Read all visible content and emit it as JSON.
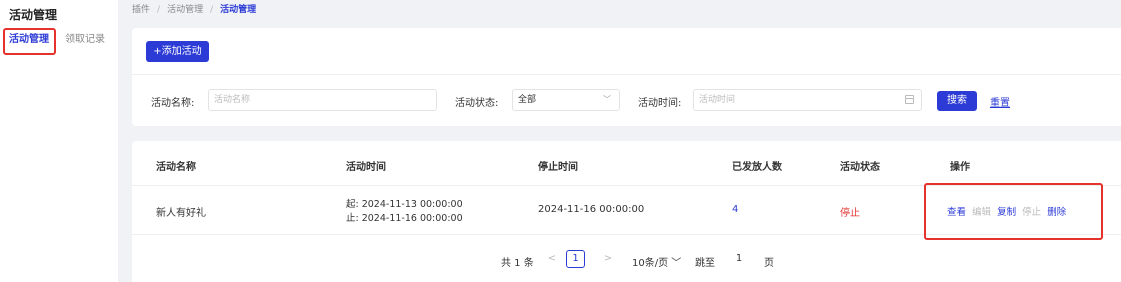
{
  "sidebar": {
    "title": "活动管理",
    "items": [
      {
        "label": "活动管理"
      },
      {
        "label": "领取记录"
      }
    ]
  },
  "breadcrumb": {
    "items": [
      "插件",
      "活动管理",
      "活动管理"
    ],
    "separator": "/"
  },
  "toolbar": {
    "add_label": "+添加活动"
  },
  "filters": {
    "name_label": "活动名称:",
    "name_placeholder": "活动名称",
    "status_label": "活动状态:",
    "status_value": "全部",
    "time_label": "活动时间:",
    "time_placeholder": "活动时间",
    "search_label": "搜索",
    "reset_label": "重置"
  },
  "table": {
    "headers": [
      "活动名称",
      "活动时间",
      "停止时间",
      "已发放人数",
      "活动状态",
      "操作"
    ],
    "rows": [
      {
        "name": "新人有好礼",
        "start": "起: 2024-11-13 00:00:00",
        "end": "止: 2024-11-16 00:00:00",
        "stop_time": "2024-11-16 00:00:00",
        "count": "4",
        "status": "停止",
        "actions": [
          "查看",
          "编辑",
          "复制",
          "停止",
          "删除"
        ]
      }
    ]
  },
  "pagination": {
    "total": "共 1 条",
    "prev": "<",
    "current": "1",
    "next": ">",
    "page_size": "10条/页",
    "jump_label": "跳至",
    "jump_value": "1",
    "page_unit": "页"
  },
  "colors": {
    "accent": "#2d3bd6",
    "danger": "#e5322d",
    "background": "#f0f2f5"
  }
}
